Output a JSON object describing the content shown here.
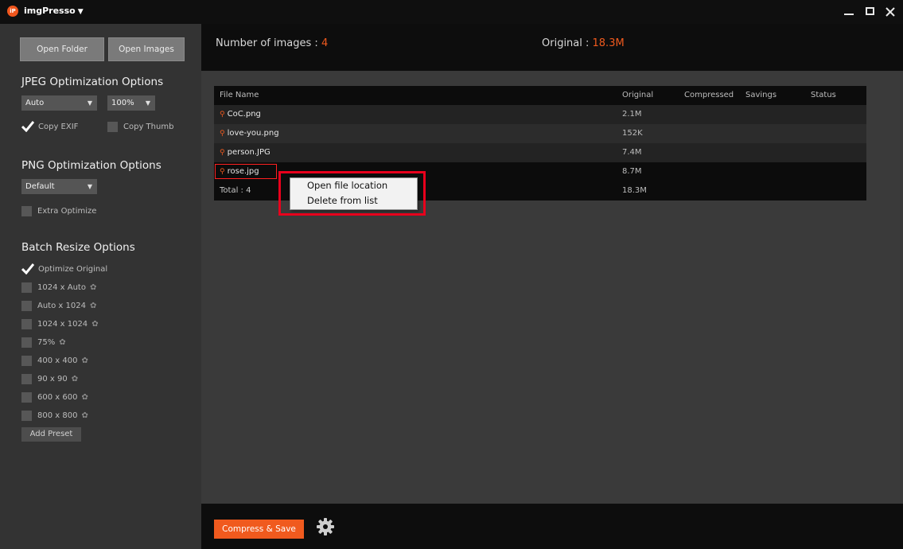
{
  "titlebar": {
    "logo_text": "iP",
    "app_name": "imgPresso",
    "menu_caret": "▼"
  },
  "sidebar": {
    "open_folder": "Open Folder",
    "open_images": "Open Images",
    "jpeg": {
      "title": "JPEG Optimization Options",
      "mode_value": "Auto",
      "quality_value": "100%",
      "copy_exif": {
        "label": "Copy EXIF",
        "checked": true
      },
      "copy_thumb": {
        "label": "Copy Thumb",
        "checked": false
      }
    },
    "png": {
      "title": "PNG Optimization Options",
      "mode_value": "Default",
      "extra_optimize": {
        "label": "Extra Optimize",
        "checked": false
      }
    },
    "resize": {
      "title": "Batch Resize Options",
      "optimize_original": {
        "label": "Optimize Original",
        "checked": true
      },
      "presets": [
        {
          "label": "1024 x Auto",
          "checked": false
        },
        {
          "label": "Auto x 1024",
          "checked": false
        },
        {
          "label": "1024 x 1024",
          "checked": false
        },
        {
          "label": "75%",
          "checked": false
        },
        {
          "label": "400 x 400",
          "checked": false
        },
        {
          "label": "90 x 90",
          "checked": false
        },
        {
          "label": "600 x 600",
          "checked": false
        },
        {
          "label": "800 x 800",
          "checked": false
        }
      ],
      "add_preset": "Add Preset"
    }
  },
  "header": {
    "count_label": "Number of images : ",
    "count_value": "4",
    "original_label": "Original : ",
    "original_value": "18.3M"
  },
  "table": {
    "columns": {
      "name": "File Name",
      "original": "Original",
      "compressed": "Compressed",
      "savings": "Savings",
      "status": "Status"
    },
    "rows": [
      {
        "name": "CoC.png",
        "original": "2.1M"
      },
      {
        "name": "love-you.png",
        "original": "152K"
      },
      {
        "name": "person.JPG",
        "original": "7.4M"
      },
      {
        "name": "rose.jpg",
        "original": "8.7M"
      }
    ],
    "total": {
      "label": "Total : 4",
      "original": "18.3M"
    }
  },
  "context_menu": {
    "items": [
      "Open file location",
      "Delete from list"
    ]
  },
  "footer": {
    "compress_save": "Compress & Save"
  },
  "colors": {
    "accent": "#f05a1e",
    "highlight_red": "#e8001c"
  },
  "icons": {
    "file_magnifier": "magnifier-icon",
    "preset_gear": "gear-icon",
    "settings": "gear-icon",
    "check": "checkmark-icon"
  }
}
